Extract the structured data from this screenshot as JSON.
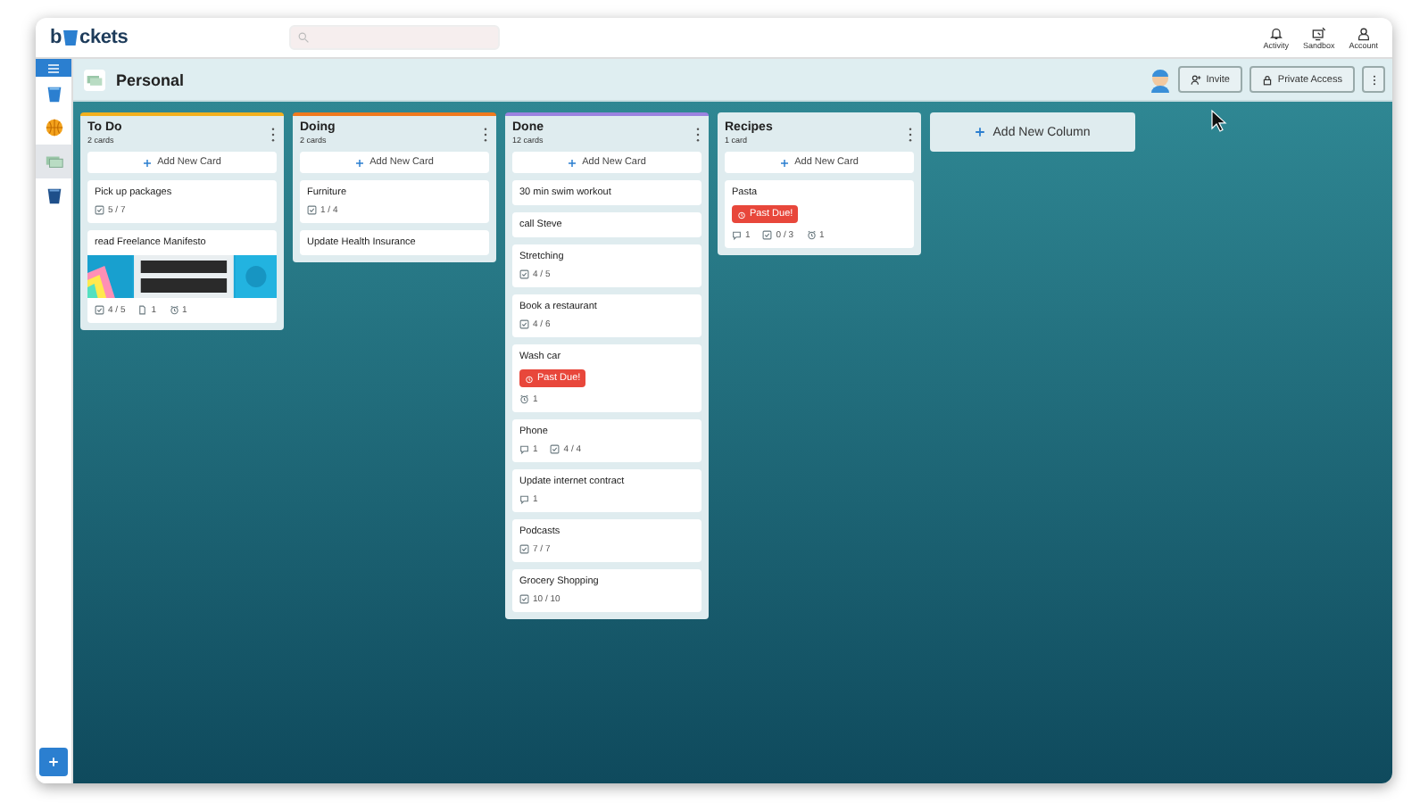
{
  "topbar": {
    "logo": [
      "b",
      "ckets"
    ],
    "actions": [
      {
        "kind": "bell",
        "label": "Activity"
      },
      {
        "kind": "sandbox",
        "label": "Sandbox"
      },
      {
        "kind": "person",
        "label": "Account"
      }
    ]
  },
  "sidebar": {
    "boards": [
      {
        "kind": "bucket",
        "selected": false
      },
      {
        "kind": "ball",
        "selected": false
      },
      {
        "kind": "cash",
        "selected": true
      },
      {
        "kind": "bucket-dark",
        "selected": false
      }
    ]
  },
  "board": {
    "title": "Personal",
    "invite": "Invite",
    "access": "Private Access"
  },
  "columns": [
    {
      "title": "To Do",
      "count": "2 cards",
      "color": "#f2b01e",
      "add": "Add New Card",
      "cards": [
        {
          "title": "Pick up packages",
          "meta": [
            {
              "kind": "checklist",
              "text": "5 / 7"
            }
          ]
        },
        {
          "title": "read Freelance Manifesto",
          "kind": "picture",
          "meta": [
            {
              "kind": "checklist",
              "text": "4 / 5"
            },
            {
              "kind": "attachment",
              "text": "1"
            },
            {
              "kind": "due",
              "text": "1"
            }
          ]
        }
      ]
    },
    {
      "title": "Doing",
      "count": "2 cards",
      "color": "#f07a1e",
      "add": "Add New Card",
      "cards": [
        {
          "title": "Furniture",
          "meta": [
            {
              "kind": "checklist",
              "text": "1 / 4"
            }
          ]
        },
        {
          "title": "Update Health Insurance"
        }
      ]
    },
    {
      "title": "Done",
      "count": "12 cards",
      "color": "#9b82e0",
      "add": "Add New Card",
      "cards": [
        {
          "title": "30 min swim workout"
        },
        {
          "title": "call Steve"
        },
        {
          "title": "Stretching",
          "meta": [
            {
              "kind": "checklist",
              "text": "4 / 5"
            }
          ]
        },
        {
          "title": "Book a restaurant",
          "meta": [
            {
              "kind": "checklist",
              "text": "4 / 6"
            }
          ]
        },
        {
          "title": "Wash car",
          "badge": "Past Due!",
          "meta": [
            {
              "kind": "due",
              "text": "1"
            }
          ]
        },
        {
          "title": "Phone",
          "meta": [
            {
              "kind": "comment",
              "text": "1"
            },
            {
              "kind": "checklist",
              "text": "4 / 4"
            }
          ]
        },
        {
          "title": "Update internet contract",
          "meta": [
            {
              "kind": "comment",
              "text": "1"
            }
          ]
        },
        {
          "title": "Podcasts",
          "meta": [
            {
              "kind": "checklist",
              "text": "7 / 7"
            }
          ]
        },
        {
          "title": "Grocery Shopping",
          "meta": [
            {
              "kind": "checklist",
              "text": "10 / 10"
            }
          ]
        }
      ]
    },
    {
      "title": "Recipes",
      "count": "1 card",
      "add": "Add New Card",
      "cards": [
        {
          "title": "Pasta",
          "badge": "Past Due!",
          "meta": [
            {
              "kind": "comment",
              "text": "1"
            },
            {
              "kind": "checklist",
              "text": "0 / 3"
            },
            {
              "kind": "due",
              "text": "1"
            }
          ]
        }
      ]
    }
  ],
  "add_column": "Add New Column"
}
